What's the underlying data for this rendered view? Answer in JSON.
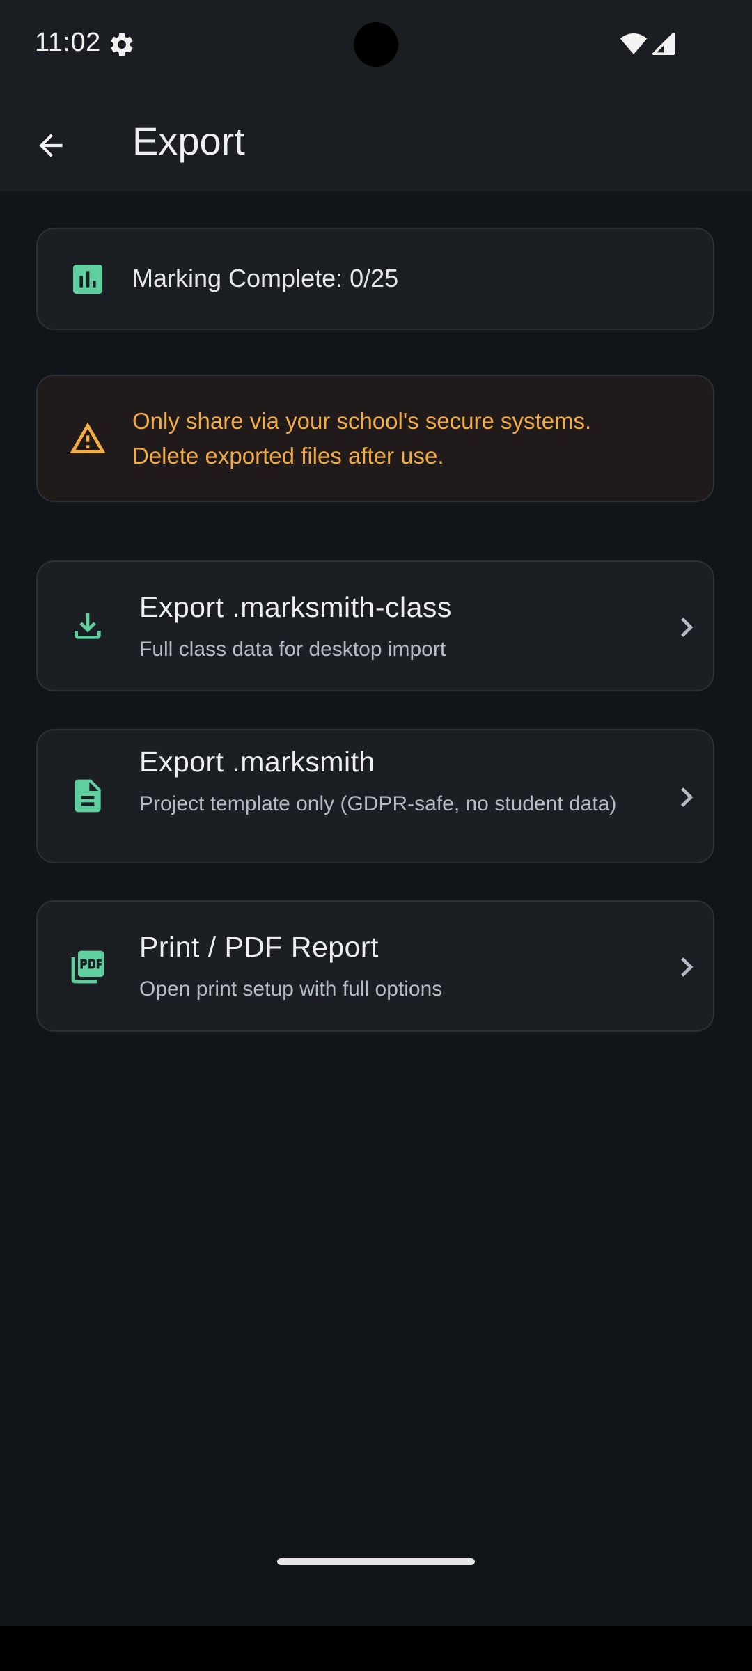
{
  "status_bar": {
    "time": "11:02",
    "icons": [
      "settings-gear-icon",
      "wifi-icon",
      "signal-icon"
    ]
  },
  "app_bar": {
    "back_icon": "arrow-back-icon",
    "title": "Export"
  },
  "progress": {
    "icon": "bar-chart-icon",
    "text": "Marking Complete: 0/25"
  },
  "warning": {
    "icon": "warning-triangle-icon",
    "line1": "Only share via your school's secure systems.",
    "line2": "Delete exported files after use."
  },
  "actions": [
    {
      "icon": "download-icon",
      "title": "Export .marksmith-class",
      "subtitle": "Full class data for desktop import"
    },
    {
      "icon": "document-icon",
      "title": "Export .marksmith",
      "subtitle": "Project template only (GDPR-safe, no student data)"
    },
    {
      "icon": "pdf-icon",
      "title": "Print / PDF Report",
      "subtitle": "Open print setup with full options"
    }
  ],
  "colors": {
    "background": "#111418",
    "surface": "#1b1f24",
    "accent_green": "#5fcf9f",
    "warning_orange": "#f2ac45",
    "warning_surface": "#211a1b"
  }
}
